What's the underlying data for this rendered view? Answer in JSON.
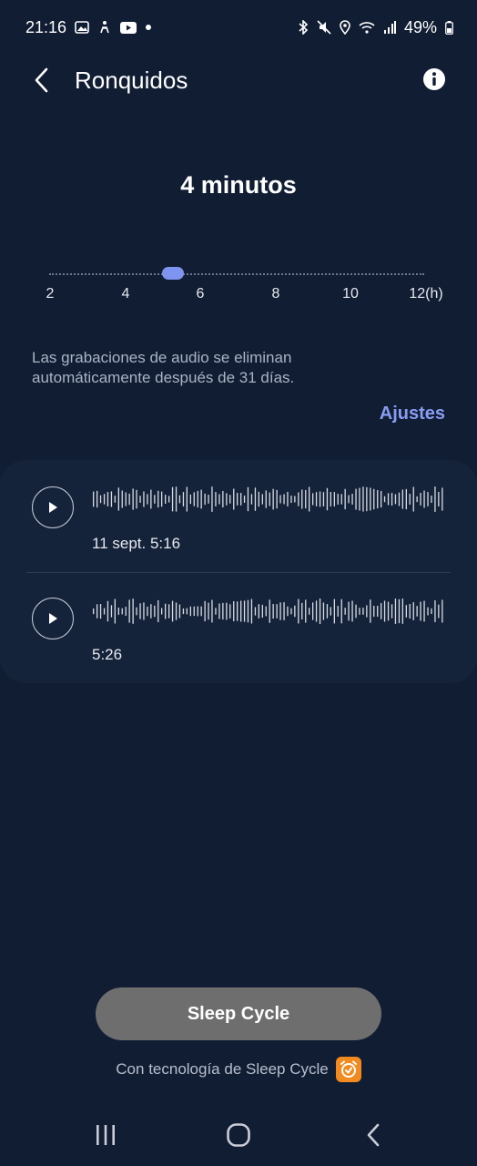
{
  "status_bar": {
    "time": "21:16",
    "left_icons": [
      "gallery-icon",
      "accessibility-icon",
      "youtube-icon",
      "dot-icon"
    ],
    "right_icons": [
      "bluetooth-icon",
      "mute-icon",
      "location-icon",
      "wifi-icon",
      "signal-icon"
    ],
    "battery": "49%"
  },
  "header": {
    "title": "Ronquidos",
    "back_icon": "chevron-left-icon",
    "info_icon": "info-icon"
  },
  "summary": {
    "duration": "4 minutos"
  },
  "slider": {
    "min": 2,
    "max": 12,
    "value": 5.3,
    "ticks": [
      "2",
      "4",
      "6",
      "8",
      "10",
      "12(h)"
    ],
    "accent_color": "#7f94f0"
  },
  "notice": {
    "text": "Las grabaciones de audio se eliminan automáticamente después de 31 días."
  },
  "settings_link": "Ajustes",
  "recordings": [
    {
      "time": "11 sept. 5:16",
      "play_icon": "play-icon"
    },
    {
      "time": "5:26",
      "play_icon": "play-icon"
    }
  ],
  "sleep_cycle_button": "Sleep Cycle",
  "powered_by": {
    "text": "Con tecnología de Sleep Cycle",
    "logo_icon": "alarm-clock-icon",
    "logo_color": "#f18a1f"
  },
  "nav_bar": {
    "icons": [
      "recents-icon",
      "home-icon",
      "back-icon"
    ]
  }
}
